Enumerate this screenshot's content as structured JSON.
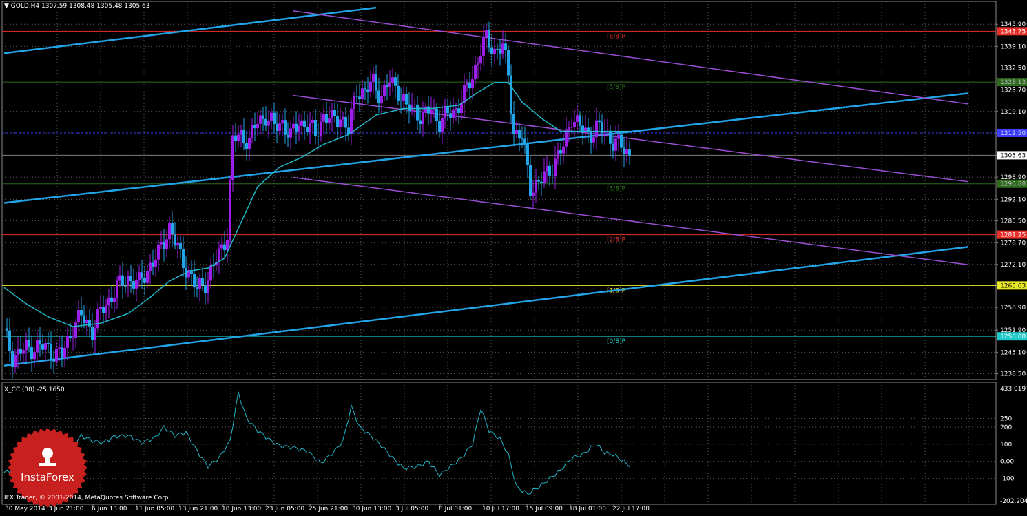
{
  "header": {
    "symbol": "GOLD,H4",
    "ohlc": "1307.59 1308.48 1305.48 1305.63"
  },
  "cci_header": {
    "name": "X_CCI(30)",
    "value": "-25.1650"
  },
  "copyright": "IFX Trader, © 2001-2014, MetaQuotes Software Corp.",
  "logo": {
    "text": "InstaForex",
    "color": "#c8201e"
  },
  "colors": {
    "bull": "#9b1fe8",
    "bear": "#23a4e8",
    "ma": "#23b7c9",
    "trend": "#23a4e8",
    "channel": "#9b4fd6",
    "grid": "#5a5a5a",
    "axis_text": "#ffffff"
  },
  "chart_data": {
    "type": "candlestick",
    "symbol": "GOLD",
    "timeframe": "H4",
    "y_ticks": [
      "1345.90",
      "1339.10",
      "1332.50",
      "1325.70",
      "1319.10",
      "1312.50",
      "1305.63",
      "1298.90",
      "1292.10",
      "1285.50",
      "1278.70",
      "1272.10",
      "1265.63",
      "1258.90",
      "1251.90",
      "1245.10",
      "1238.50"
    ],
    "y_range": [
      1236.7,
      1350.6
    ],
    "x_ticks": [
      "30 May 2014",
      "3 Jun 21:00",
      "6 Jun 13:00",
      "11 Jun 05:00",
      "13 Jun 21:00",
      "18 Jun 13:00",
      "23 Jun 05:00",
      "25 Jun 21:00",
      "30 Jun 13:00",
      "3 Jul 05:00",
      "8 Jul 01:00",
      "10 Jul 17:00",
      "15 Jul 09:00",
      "18 Jul 01:00",
      "22 Jul 17:00"
    ],
    "price_levels": [
      {
        "label": "[6/8]P",
        "value": 1343.75,
        "axis_label": "1343.75",
        "color": "#e8302a",
        "label_color": "#e8302a",
        "axis_text_color": "#ffffff"
      },
      {
        "label": "[5/8]P",
        "value": 1328.13,
        "axis_label": "1328.13",
        "color": "#2f6b1f",
        "label_color": "#2f7d1e",
        "axis_text_color": "#b7b7b7"
      },
      {
        "label": "",
        "value": 1312.5,
        "axis_label": "1312.50",
        "color": "#3d3dff",
        "label_color": "#3d3dff",
        "axis_text_color": "#d6d6ff",
        "dashed": true
      },
      {
        "label": "",
        "value": 1305.63,
        "axis_label": "1305.63",
        "color": "#7a7a7a",
        "label_color": "#7a7a7a",
        "axis_text_color": "#000000",
        "axis_bg": "#ffffff"
      },
      {
        "label": "[3/8]P",
        "value": 1296.88,
        "axis_label": "1296.88",
        "color": "#2f6b1f",
        "label_color": "#2f7d1e",
        "axis_text_color": "#b7b7b7"
      },
      {
        "label": "[2/8]P",
        "value": 1281.25,
        "axis_label": "1281.25",
        "color": "#e8302a",
        "label_color": "#e8302a",
        "axis_text_color": "#ffffff"
      },
      {
        "label": "[1/8]P",
        "value": 1265.63,
        "axis_label": "1265.63",
        "color": "#e8e82a",
        "label_color": "#e8e82a",
        "axis_text_color": "#000000"
      },
      {
        "label": "[0/8]P",
        "value": 1250.0,
        "axis_label": "1250.00",
        "color": "#1ec9c9",
        "label_color": "#1ec9c9",
        "axis_text_color": "#ffffff"
      }
    ],
    "price_anchors": [
      [
        0,
        1251
      ],
      [
        3,
        1244
      ],
      [
        8,
        1246
      ],
      [
        12,
        1247
      ],
      [
        16,
        1246
      ],
      [
        21,
        1244
      ],
      [
        25,
        1253
      ],
      [
        28,
        1256
      ],
      [
        32,
        1252
      ],
      [
        35,
        1257
      ],
      [
        40,
        1264
      ],
      [
        45,
        1268
      ],
      [
        49,
        1266
      ],
      [
        53,
        1272
      ],
      [
        56,
        1275
      ],
      [
        60,
        1284
      ],
      [
        64,
        1274
      ],
      [
        67,
        1270
      ],
      [
        70,
        1264
      ],
      [
        74,
        1268
      ],
      [
        78,
        1275
      ],
      [
        81,
        1282
      ],
      [
        83,
        1310
      ],
      [
        86,
        1312
      ],
      [
        89,
        1310
      ],
      [
        92,
        1316
      ],
      [
        95,
        1318
      ],
      [
        98,
        1314
      ],
      [
        101,
        1316
      ],
      [
        104,
        1311
      ],
      [
        107,
        1316
      ],
      [
        110,
        1315
      ],
      [
        113,
        1312
      ],
      [
        116,
        1318
      ],
      [
        119,
        1316
      ],
      [
        122,
        1318
      ],
      [
        125,
        1313
      ],
      [
        128,
        1326
      ],
      [
        131,
        1325
      ],
      [
        134,
        1328
      ],
      [
        137,
        1324
      ],
      [
        140,
        1328
      ],
      [
        143,
        1326
      ],
      [
        146,
        1320
      ],
      [
        149,
        1320
      ],
      [
        152,
        1317
      ],
      [
        155,
        1320
      ],
      [
        158,
        1316
      ],
      [
        161,
        1318
      ],
      [
        164,
        1320
      ],
      [
        167,
        1324
      ],
      [
        170,
        1330
      ],
      [
        173,
        1338
      ],
      [
        175,
        1341
      ],
      [
        178,
        1338
      ],
      [
        181,
        1339
      ],
      [
        183,
        1330
      ],
      [
        185,
        1313
      ],
      [
        188,
        1311
      ],
      [
        191,
        1296
      ],
      [
        194,
        1297
      ],
      [
        197,
        1300
      ],
      [
        200,
        1304
      ],
      [
        203,
        1308
      ],
      [
        206,
        1318
      ],
      [
        209,
        1314
      ],
      [
        212,
        1312
      ],
      [
        215,
        1314
      ],
      [
        218,
        1313
      ],
      [
        221,
        1310
      ],
      [
        224,
        1308
      ],
      [
        227,
        1306
      ]
    ],
    "ma_anchors": [
      [
        0,
        1265
      ],
      [
        8,
        1260
      ],
      [
        16,
        1256
      ],
      [
        25,
        1253
      ],
      [
        35,
        1254
      ],
      [
        45,
        1257
      ],
      [
        53,
        1262
      ],
      [
        60,
        1267
      ],
      [
        67,
        1270
      ],
      [
        74,
        1271
      ],
      [
        80,
        1274
      ],
      [
        86,
        1285
      ],
      [
        92,
        1296
      ],
      [
        100,
        1302
      ],
      [
        108,
        1305
      ],
      [
        116,
        1309
      ],
      [
        125,
        1312
      ],
      [
        135,
        1318
      ],
      [
        145,
        1320
      ],
      [
        155,
        1320
      ],
      [
        165,
        1321
      ],
      [
        172,
        1325
      ],
      [
        178,
        1328
      ],
      [
        183,
        1328
      ],
      [
        188,
        1322
      ],
      [
        195,
        1317
      ],
      [
        202,
        1313
      ],
      [
        210,
        1313
      ],
      [
        218,
        1313
      ],
      [
        227,
        1313
      ]
    ],
    "trendlines": [
      {
        "kind": "trend",
        "p1": [
          0,
          1337.0
        ],
        "p2": [
          135,
          1351.0
        ]
      },
      {
        "kind": "trend",
        "p1": [
          0,
          1291.0
        ],
        "p2": [
          350,
          1324.7
        ]
      },
      {
        "kind": "trend",
        "p1": [
          0,
          1241.0
        ],
        "p2": [
          350,
          1277.5
        ]
      },
      {
        "kind": "channel",
        "p1": [
          105,
          1350.0
        ],
        "p2": [
          350,
          1321.4
        ]
      },
      {
        "kind": "channel",
        "p1": [
          105,
          1324.0
        ],
        "p2": [
          350,
          1297.5
        ]
      },
      {
        "kind": "channel",
        "p1": [
          105,
          1298.8
        ],
        "p2": [
          350,
          1272.0
        ]
      }
    ],
    "cci": {
      "name": "X_CCI(30)",
      "last": -25.165,
      "ticks": [
        "433.0197",
        "250",
        "200",
        "100",
        "0.00",
        "-100",
        "-202.2045"
      ],
      "range": [
        -202.2045,
        433.0197
      ],
      "anchors": [
        [
          0,
          -65
        ],
        [
          5,
          -40
        ],
        [
          10,
          -20
        ],
        [
          15,
          30
        ],
        [
          20,
          80
        ],
        [
          25,
          90
        ],
        [
          28,
          150
        ],
        [
          32,
          120
        ],
        [
          36,
          110
        ],
        [
          40,
          145
        ],
        [
          45,
          150
        ],
        [
          50,
          110
        ],
        [
          55,
          140
        ],
        [
          58,
          200
        ],
        [
          62,
          150
        ],
        [
          66,
          170
        ],
        [
          70,
          60
        ],
        [
          74,
          -30
        ],
        [
          78,
          20
        ],
        [
          82,
          120
        ],
        [
          85,
          400
        ],
        [
          88,
          250
        ],
        [
          92,
          180
        ],
        [
          96,
          130
        ],
        [
          100,
          90
        ],
        [
          105,
          80
        ],
        [
          110,
          60
        ],
        [
          115,
          -10
        ],
        [
          120,
          60
        ],
        [
          123,
          120
        ],
        [
          126,
          320
        ],
        [
          129,
          200
        ],
        [
          133,
          150
        ],
        [
          137,
          90
        ],
        [
          141,
          20
        ],
        [
          145,
          -40
        ],
        [
          150,
          -30
        ],
        [
          154,
          0
        ],
        [
          158,
          -80
        ],
        [
          162,
          -30
        ],
        [
          166,
          20
        ],
        [
          170,
          100
        ],
        [
          173,
          310
        ],
        [
          176,
          180
        ],
        [
          180,
          130
        ],
        [
          183,
          40
        ],
        [
          186,
          -150
        ],
        [
          190,
          -190
        ],
        [
          194,
          -150
        ],
        [
          198,
          -100
        ],
        [
          202,
          -50
        ],
        [
          206,
          20
        ],
        [
          210,
          40
        ],
        [
          213,
          80
        ],
        [
          215,
          100
        ],
        [
          218,
          50
        ],
        [
          221,
          40
        ],
        [
          224,
          10
        ],
        [
          227,
          -25
        ]
      ]
    }
  }
}
